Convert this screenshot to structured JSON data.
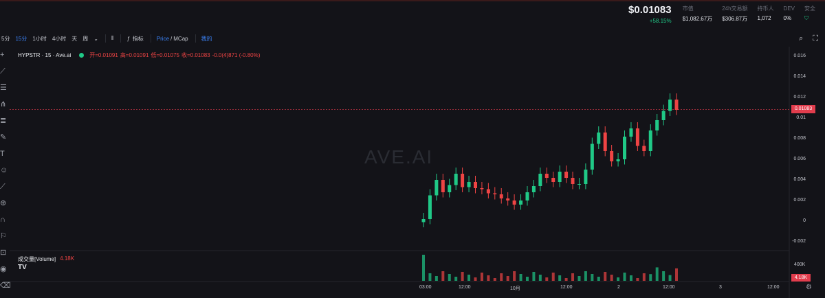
{
  "stats": {
    "price": "$0.01083",
    "change": "+58.15%",
    "items": [
      {
        "label": "市值",
        "value": "$1,082.67万"
      },
      {
        "label": "24h交易额",
        "value": "$306.87万"
      },
      {
        "label": "持币人",
        "value": "1,072"
      },
      {
        "label": "DEV",
        "value": "0%"
      },
      {
        "label": "安全",
        "value": ""
      }
    ],
    "accent_color": "#20c987"
  },
  "toolbar": {
    "intervals": [
      "5分",
      "15分",
      "1小时",
      "4小时",
      "天",
      "周"
    ],
    "active_interval": "15分",
    "indicators_label": "指标",
    "price_label": "Price",
    "mcap_label": "MCap",
    "mine_label": "我的"
  },
  "legend": {
    "symbol": "HYPSTR · 15 · Ave.ai",
    "open": "开=0.01091",
    "high": "高=0.01091",
    "low": "低=0.01075",
    "close": "收=0.01083",
    "change": "-0.0(4)871 (-0.80%)"
  },
  "watermark": "AVE.AI",
  "volume": {
    "label": "成交量[Volume]",
    "value": "4.18K",
    "axis_label": "400K"
  },
  "price_axis": {
    "ticks": [
      "0.016",
      "0.014",
      "0.012",
      "0.01",
      "0.008",
      "0.006",
      "0.004",
      "0.002",
      "0",
      "-0.002"
    ],
    "current": "0.01083"
  },
  "time_axis": [
    "03:00",
    "12:00",
    "10月",
    "12:00",
    "2",
    "12:00",
    "3",
    "12:00"
  ],
  "chart_data": {
    "type": "line",
    "title": "",
    "xlabel": "",
    "ylabel": "",
    "ylim": [
      -0.002,
      0.016
    ],
    "series": [
      {
        "values": [
          0.0002,
          0.0025,
          0.004,
          0.0028,
          0.0035,
          0.0046,
          0.0033,
          0.0038,
          0.0032,
          0.0031,
          0.0027,
          0.0026,
          0.0022,
          0.002,
          0.0016,
          0.002,
          0.0028,
          0.0034,
          0.0046,
          0.0042,
          0.0038,
          0.0048,
          0.0042,
          0.0036,
          0.0036,
          0.005,
          0.0075,
          0.0086,
          0.0068,
          0.0058,
          0.006,
          0.0082,
          0.009,
          0.0073,
          0.0068,
          0.0088,
          0.0098,
          0.0107,
          0.0118,
          0.0108
        ]
      }
    ]
  }
}
